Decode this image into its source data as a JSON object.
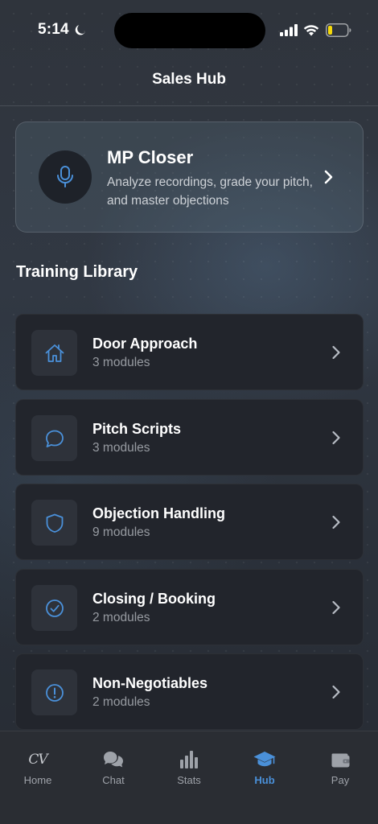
{
  "status_bar": {
    "time": "5:14",
    "icons": [
      "moon-icon",
      "signal-icon",
      "wifi-icon",
      "battery-icon"
    ]
  },
  "header": {
    "title": "Sales Hub"
  },
  "feature_card": {
    "title": "MP Closer",
    "description": "Analyze recordings, grade your pitch, and master objections",
    "icon": "microphone-icon"
  },
  "library": {
    "title": "Training Library",
    "items": [
      {
        "title": "Door Approach",
        "subtitle": "3 modules",
        "icon": "home-icon"
      },
      {
        "title": "Pitch Scripts",
        "subtitle": "3 modules",
        "icon": "chat-bubble-icon"
      },
      {
        "title": "Objection Handling",
        "subtitle": "9 modules",
        "icon": "shield-icon"
      },
      {
        "title": "Closing / Booking",
        "subtitle": "2 modules",
        "icon": "check-circle-icon"
      },
      {
        "title": "Non-Negotiables",
        "subtitle": "2 modules",
        "icon": "alert-circle-icon"
      }
    ]
  },
  "tab_bar": {
    "active": "Hub",
    "tabs": [
      {
        "label": "Home",
        "icon": "cv-logo-icon"
      },
      {
        "label": "Chat",
        "icon": "chat-bubbles-icon"
      },
      {
        "label": "Stats",
        "icon": "bar-chart-icon"
      },
      {
        "label": "Hub",
        "icon": "graduation-cap-icon"
      },
      {
        "label": "Pay",
        "icon": "wallet-icon"
      }
    ]
  },
  "colors": {
    "accent": "#4a90d9",
    "card_bg": "#22252c",
    "battery_low": "#f5d90a"
  }
}
